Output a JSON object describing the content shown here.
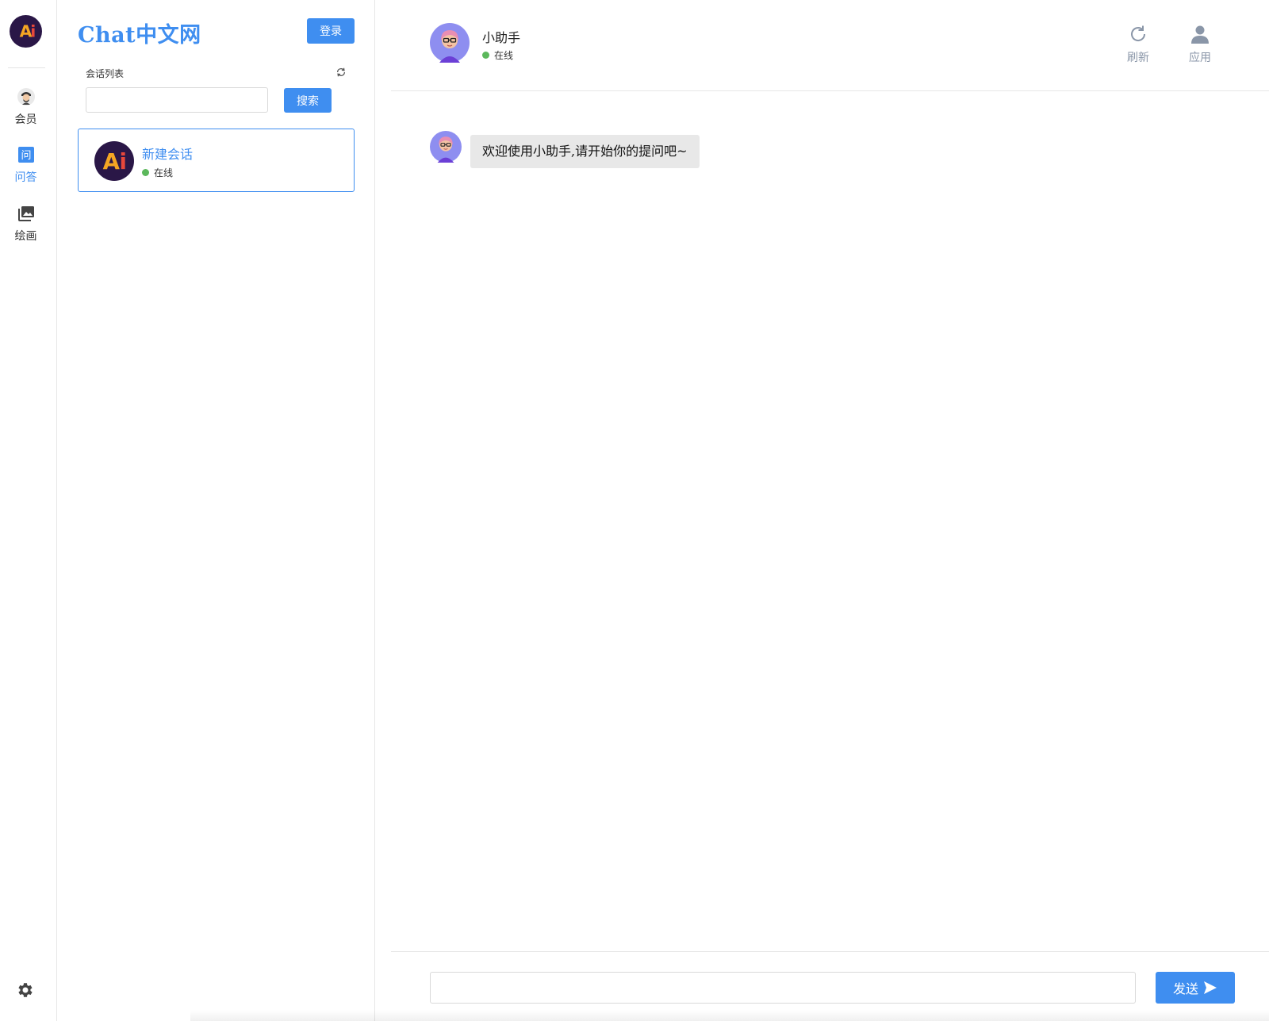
{
  "rail": {
    "items": [
      {
        "label": "会员",
        "icon": "member-avatar-icon"
      },
      {
        "label": "问答",
        "icon": "qa-icon",
        "active": true
      },
      {
        "label": "绘画",
        "icon": "gallery-icon"
      }
    ],
    "settings_icon": "gear-icon"
  },
  "panel": {
    "brand": "Chat中文网",
    "login_label": "登录",
    "list_label": "会话列表",
    "search": {
      "value": "",
      "placeholder": "",
      "button_label": "搜索"
    },
    "conversations": [
      {
        "name": "新建会话",
        "status": "在线"
      }
    ]
  },
  "chat": {
    "bot_name": "小助手",
    "bot_status": "在线",
    "actions": [
      {
        "label": "刷新",
        "icon": "refresh-icon"
      },
      {
        "label": "应用",
        "icon": "user-icon"
      }
    ],
    "messages": [
      {
        "from": "bot",
        "text": "欢迎使用小助手,请开始你的提问吧~"
      }
    ],
    "composer": {
      "value": "",
      "placeholder": "",
      "send_label": "发送"
    }
  },
  "colors": {
    "accent": "#3f8ef0",
    "online": "#5cb85c",
    "bubble": "#e8e8e8"
  }
}
